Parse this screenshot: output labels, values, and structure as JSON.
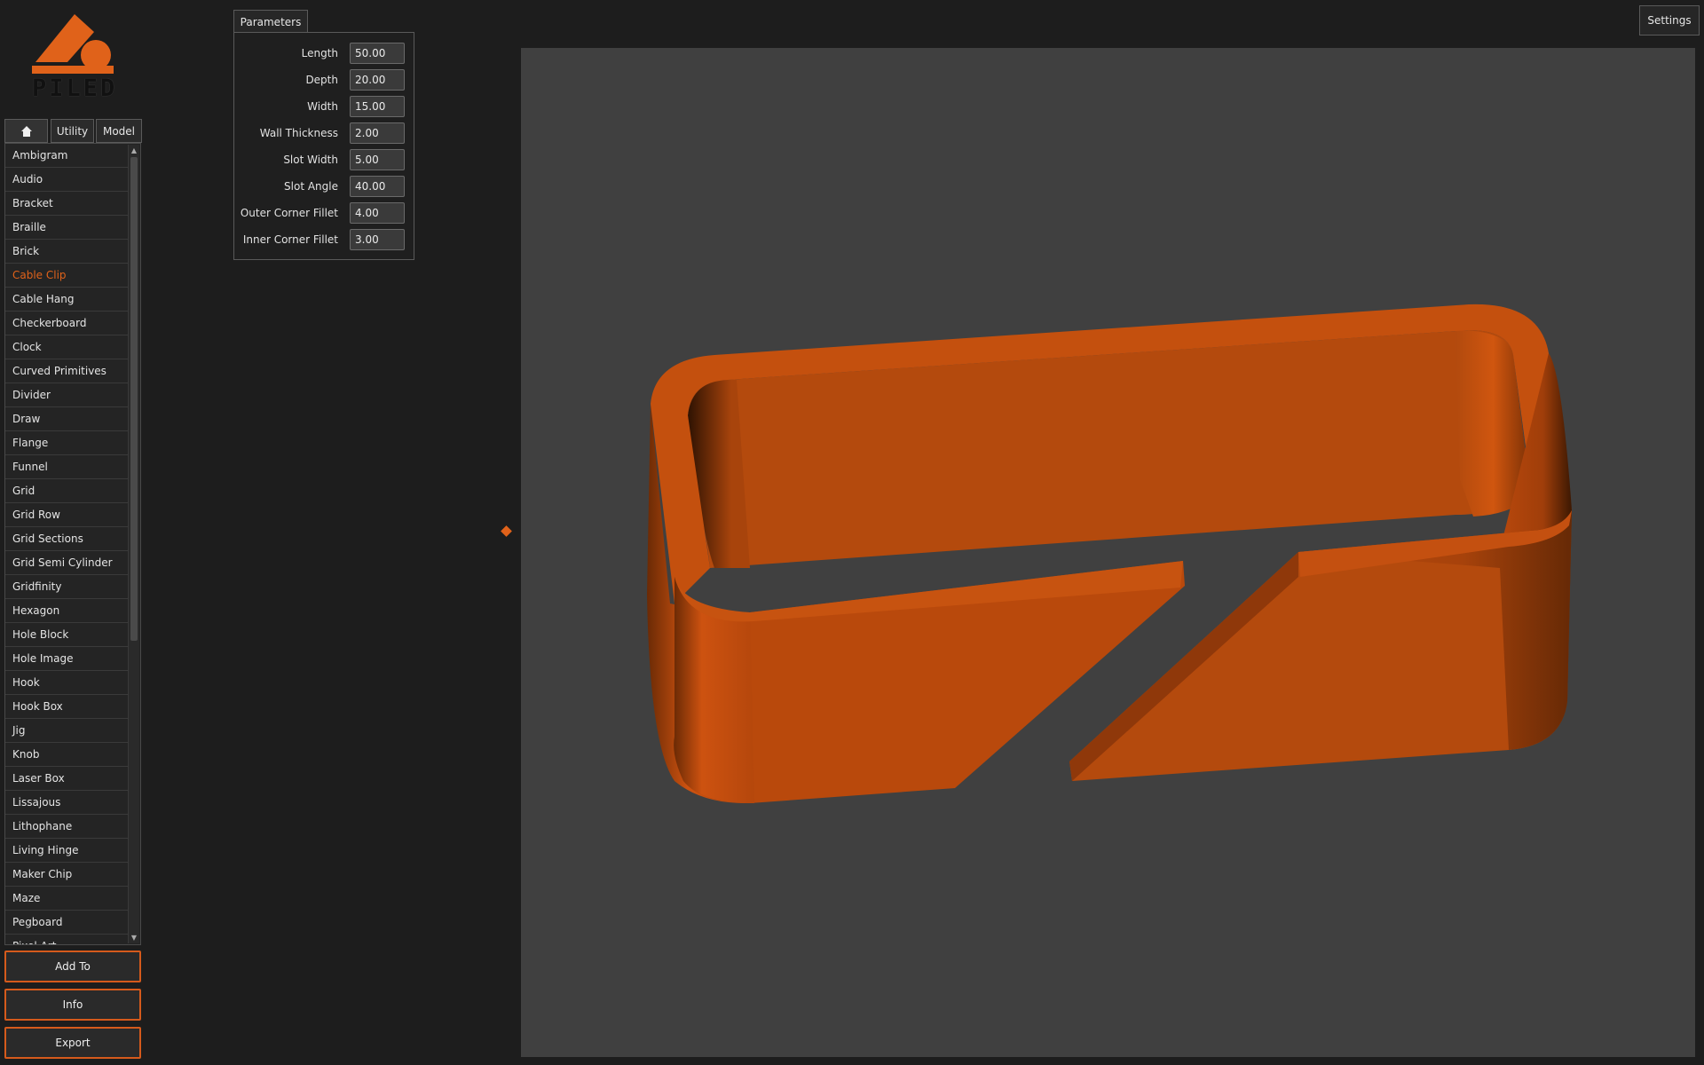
{
  "logo": {
    "text": "PILED"
  },
  "tabs": {
    "home_icon": "home-icon",
    "utility": "Utility",
    "model": "Model"
  },
  "sidebar": {
    "items": [
      {
        "label": "Ambigram"
      },
      {
        "label": "Audio"
      },
      {
        "label": "Bracket"
      },
      {
        "label": "Braille"
      },
      {
        "label": "Brick"
      },
      {
        "label": "Cable Clip",
        "selected": true
      },
      {
        "label": "Cable Hang"
      },
      {
        "label": "Checkerboard"
      },
      {
        "label": "Clock"
      },
      {
        "label": "Curved Primitives"
      },
      {
        "label": "Divider"
      },
      {
        "label": "Draw"
      },
      {
        "label": "Flange"
      },
      {
        "label": "Funnel"
      },
      {
        "label": "Grid"
      },
      {
        "label": "Grid Row"
      },
      {
        "label": "Grid Sections"
      },
      {
        "label": "Grid Semi Cylinder"
      },
      {
        "label": "Gridfinity"
      },
      {
        "label": "Hexagon"
      },
      {
        "label": "Hole Block"
      },
      {
        "label": "Hole Image"
      },
      {
        "label": "Hook"
      },
      {
        "label": "Hook Box"
      },
      {
        "label": "Jig"
      },
      {
        "label": "Knob"
      },
      {
        "label": "Laser Box"
      },
      {
        "label": "Lissajous"
      },
      {
        "label": "Lithophane"
      },
      {
        "label": "Living Hinge"
      },
      {
        "label": "Maker Chip"
      },
      {
        "label": "Maze"
      },
      {
        "label": "Pegboard"
      },
      {
        "label": "Pixel Art"
      }
    ]
  },
  "actions": {
    "add_to": "Add To",
    "info": "Info",
    "export": "Export"
  },
  "parameters": {
    "tab_label": "Parameters",
    "fields": [
      {
        "label": "Length",
        "value": "50.00"
      },
      {
        "label": "Depth",
        "value": "20.00"
      },
      {
        "label": "Width",
        "value": "15.00"
      },
      {
        "label": "Wall Thickness",
        "value": "2.00"
      },
      {
        "label": "Slot Width",
        "value": "5.00"
      },
      {
        "label": "Slot Angle",
        "value": "40.00"
      },
      {
        "label": "Outer Corner Fillet",
        "value": "4.00"
      },
      {
        "label": "Inner Corner Fillet",
        "value": "3.00"
      }
    ]
  },
  "settings": {
    "label": "Settings"
  },
  "colors": {
    "accent": "#e0621a",
    "model": "#b8480c",
    "viewport_bg": "#404040",
    "app_bg": "#1d1d1d"
  }
}
